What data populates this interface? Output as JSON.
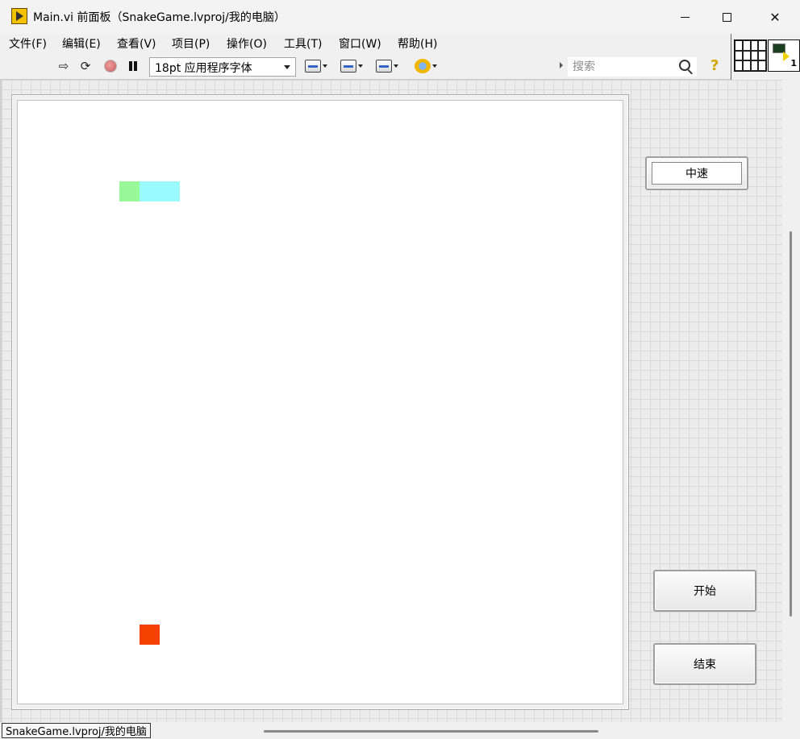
{
  "window": {
    "title": "Main.vi 前面板（SnakeGame.lvproj/我的电脑）"
  },
  "menu": [
    "文件(F)",
    "编辑(E)",
    "查看(V)",
    "项目(P)",
    "操作(O)",
    "工具(T)",
    "窗口(W)",
    "帮助(H)"
  ],
  "toolbar": {
    "font": "18pt 应用程序字体",
    "search_placeholder": "搜索"
  },
  "vi_icon": {
    "number": "1"
  },
  "controls": {
    "speed_label": "中速",
    "start_label": "开始",
    "end_label": "结束"
  },
  "statusbar": {
    "path": "SnakeGame.lvproj/我的电脑"
  },
  "colors": {
    "snake_head": "#98f898",
    "snake_body": "#99fbff",
    "food": "#f54100",
    "board": "#ffffff"
  }
}
